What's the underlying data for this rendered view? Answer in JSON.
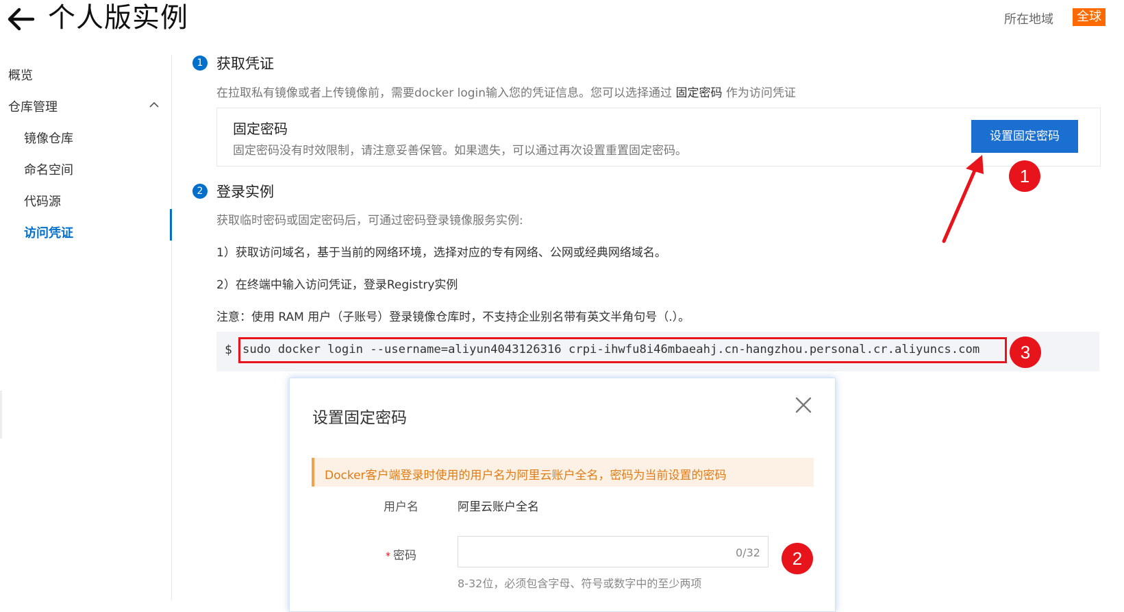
{
  "header": {
    "title": "个人版实例",
    "region_label": "所在地域",
    "region_value": "全球"
  },
  "sidebar": {
    "overview": "概览",
    "repo_management": "仓库管理",
    "image_repo": "镜像仓库",
    "namespace": "命名空间",
    "code_source": "代码源",
    "access_credentials": "访问凭证"
  },
  "step1": {
    "number": "1",
    "title": "获取凭证",
    "desc_prefix": "在拉取私有镜像或者上传镜像前，需要docker login输入您的凭证信息。您可以选择通过 ",
    "desc_highlight": "固定密码",
    "desc_suffix": " 作为访问凭证",
    "card_title": "固定密码",
    "card_desc": "固定密码没有时效限制，请注意妥善保管。如果遗失，可以通过再次设置重置固定密码。",
    "button_label": "设置固定密码"
  },
  "step2": {
    "number": "2",
    "title": "登录实例",
    "desc": "获取临时密码或固定密码后，可通过密码登录镜像服务实例:",
    "line_a": "1）获取访问域名，基于当前的网络环境，选择对应的专有网络、公网或经典网络域名。",
    "line_b": "2）在终端中输入访问凭证，登录Registry实例",
    "note": "注意：使用 RAM 用户（子账号）登录镜像仓库时，不支持企业别名带有英文半角句号（.）。",
    "prompt": "$",
    "command": "sudo docker login --username=aliyun4043126316 crpi-ihwfu8i46mbaeahj.cn-hangzhou.personal.cr.aliyuncs.com"
  },
  "annotations": {
    "badge1": "1",
    "badge2": "2",
    "badge3": "3",
    "color": "#e8141b"
  },
  "dialog": {
    "title": "设置固定密码",
    "warning": "Docker客户端登录时使用的用户名为阿里云账户全名，密码为当前设置的密码",
    "username_label": "用户名",
    "username_value": "阿里云账户全名",
    "required_mark": "*",
    "password_label": "密码",
    "password_value": "",
    "password_counter": "0/32",
    "password_hint": "8-32位，必须包含字母、符号或数字中的至少两项"
  },
  "colors": {
    "accent": "#0070cc",
    "button": "#1b6fd0",
    "region_badge": "#ff6a00",
    "warning_text": "#e07b13"
  }
}
